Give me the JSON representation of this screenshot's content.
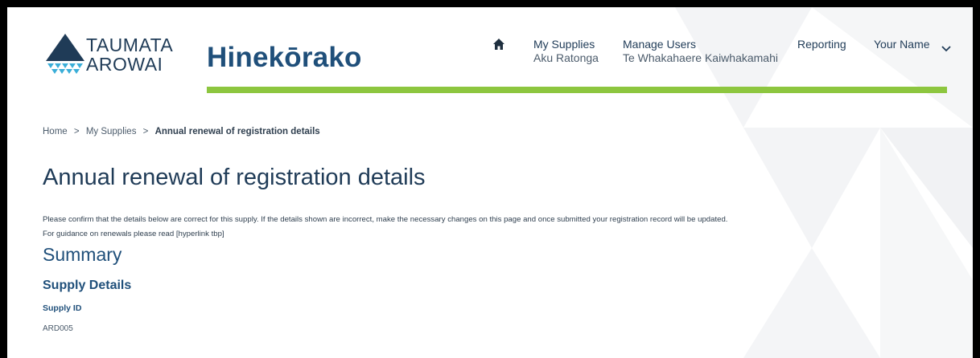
{
  "header": {
    "logo_line1": "TAUMATA",
    "logo_line2": "AROWAI",
    "brand": "Hinekōrako",
    "nav": {
      "my_supplies": "My Supplies",
      "my_supplies_sub": "Aku Ratonga",
      "manage_users": "Manage Users",
      "manage_users_sub": "Te Whakahaere Kaiwhakamahi",
      "reporting": "Reporting",
      "user": "Your Name"
    }
  },
  "breadcrumb": {
    "home": "Home",
    "my_supplies": "My Supplies",
    "current": "Annual renewal of registration details",
    "separator": ">"
  },
  "main": {
    "title": "Annual renewal of registration details",
    "intro1": "Please confirm that the details below are correct for this supply.  If the details shown are incorrect, make the necessary changes on this page and once submitted your registration record will be updated.",
    "intro2": "For guidance on renewals please read [hyperlink tbp]",
    "summary_heading": "Summary",
    "supply_details_heading": "Supply Details",
    "supply_id_label": "Supply ID",
    "supply_id_value": "ARD005"
  },
  "colors": {
    "accent_green": "#8dc63f",
    "brand_blue": "#1f4f7a",
    "text_dark": "#1f3b57"
  }
}
